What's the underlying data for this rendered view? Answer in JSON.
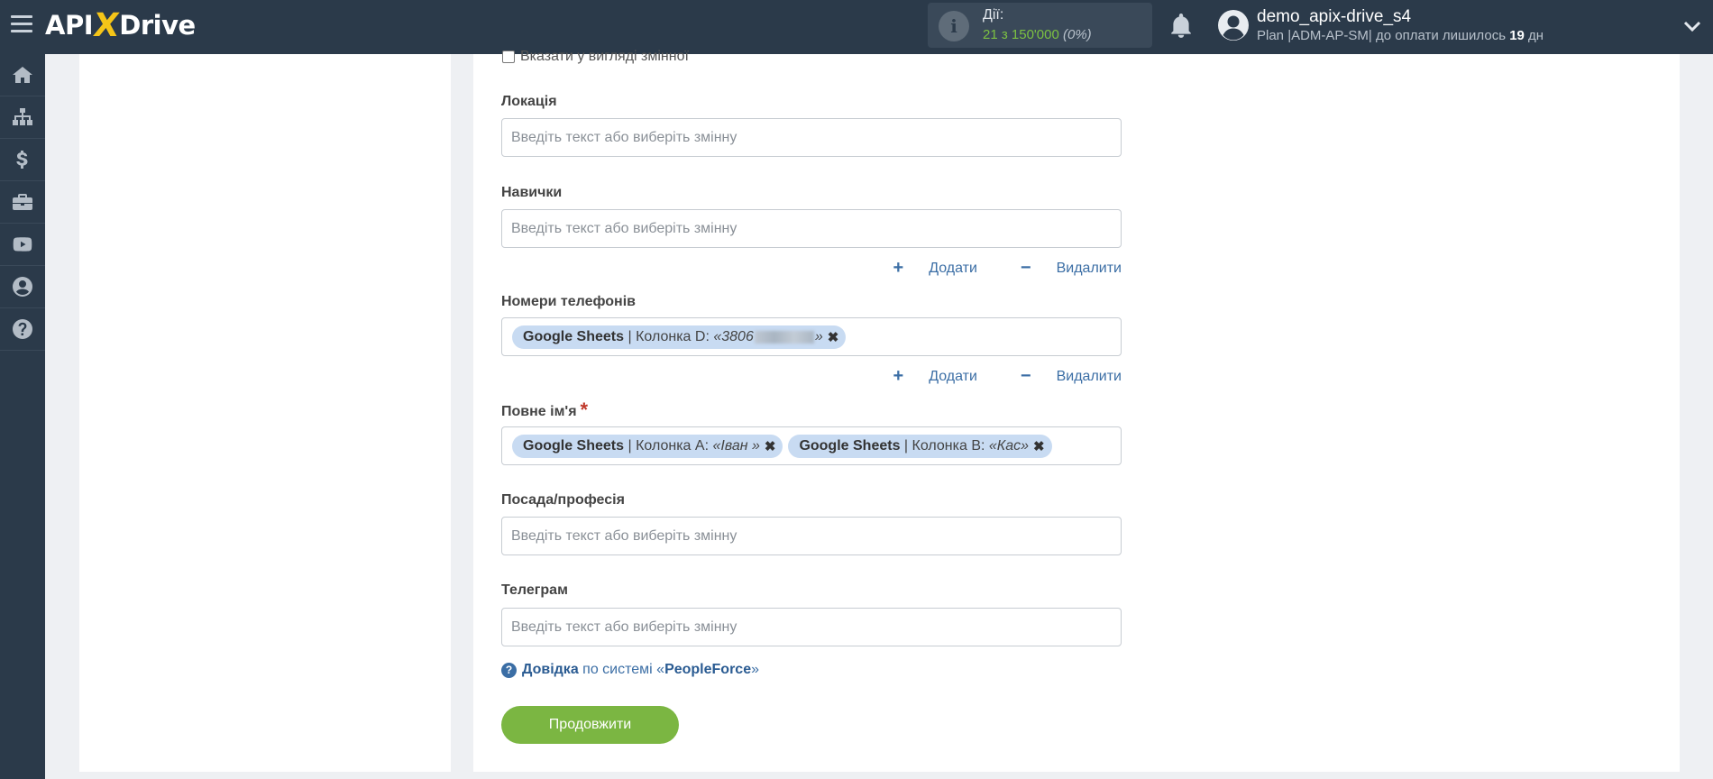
{
  "header": {
    "logo": {
      "left": "API",
      "x": "X",
      "right": "Drive"
    },
    "actions_label": "Дії:",
    "actions_value": "21 з 150'000",
    "actions_percent": "(0%)",
    "user_name": "demo_apix-drive_s4",
    "plan_text": "Plan |ADM-AP-SM| до оплати лишилось",
    "plan_days": "19",
    "plan_suffix": "дн"
  },
  "sidebar": {
    "items": [
      "home-icon",
      "sitemap-icon",
      "dollar-icon",
      "briefcase-icon",
      "youtube-icon",
      "user-icon",
      "help-icon"
    ]
  },
  "form": {
    "variable_checkbox_label": "Вказати у вигляді змінної",
    "placeholder": "Введіть текст або виберіть змінну",
    "fields": {
      "location": {
        "label": "Локація"
      },
      "skills": {
        "label": "Навички"
      },
      "phones": {
        "label": "Номери телефонів",
        "tags": [
          {
            "source": "Google Sheets",
            "column": "| Колонка D:",
            "value_prefix": "«3806",
            "value_suffix": "»"
          }
        ]
      },
      "full_name": {
        "label": "Повне ім'я",
        "required_mark": "*",
        "tags": [
          {
            "source": "Google Sheets",
            "column": "| Колонка A:",
            "value": "«Іван »"
          },
          {
            "source": "Google Sheets",
            "column": "| Колонка B:",
            "value": "«Кас»"
          }
        ]
      },
      "position": {
        "label": "Посада/професія"
      },
      "telegram": {
        "label": "Телеграм"
      }
    },
    "add_label": "Додати",
    "remove_label": "Видалити",
    "help": {
      "link": "Довідка",
      "middle": "по системі «",
      "system": "PeopleForce",
      "end": "»"
    },
    "continue_label": "Продовжити"
  },
  "colors": {
    "topbar": "#2b3a4a",
    "accent_green": "#7bb642",
    "link_blue": "#3b6ea5",
    "tag_bg": "#c8dbf2"
  }
}
